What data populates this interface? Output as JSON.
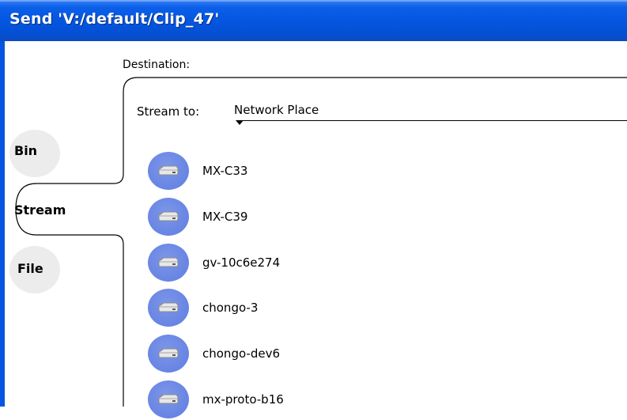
{
  "window": {
    "title": "Send 'V:/default/Clip_47'"
  },
  "destination_label": "Destination:",
  "tabs": [
    {
      "label": "Bin",
      "selected": false
    },
    {
      "label": "Stream",
      "selected": true
    },
    {
      "label": "File",
      "selected": false
    }
  ],
  "stream_to": {
    "label": "Stream to:",
    "value": "Network Place"
  },
  "network_places": [
    {
      "name": "MX-C33"
    },
    {
      "name": "MX-C39"
    },
    {
      "name": "gv-10c6e274"
    },
    {
      "name": "chongo-3"
    },
    {
      "name": "chongo-dev6"
    },
    {
      "name": "mx-proto-b16"
    }
  ],
  "colors": {
    "titlebar": "#0556e0",
    "tab_bubble": "#ececec",
    "item_icon": "#6a87e4"
  },
  "icons": {
    "network_place": "hard-drive-icon",
    "dropdown": "triangle-down-icon"
  }
}
